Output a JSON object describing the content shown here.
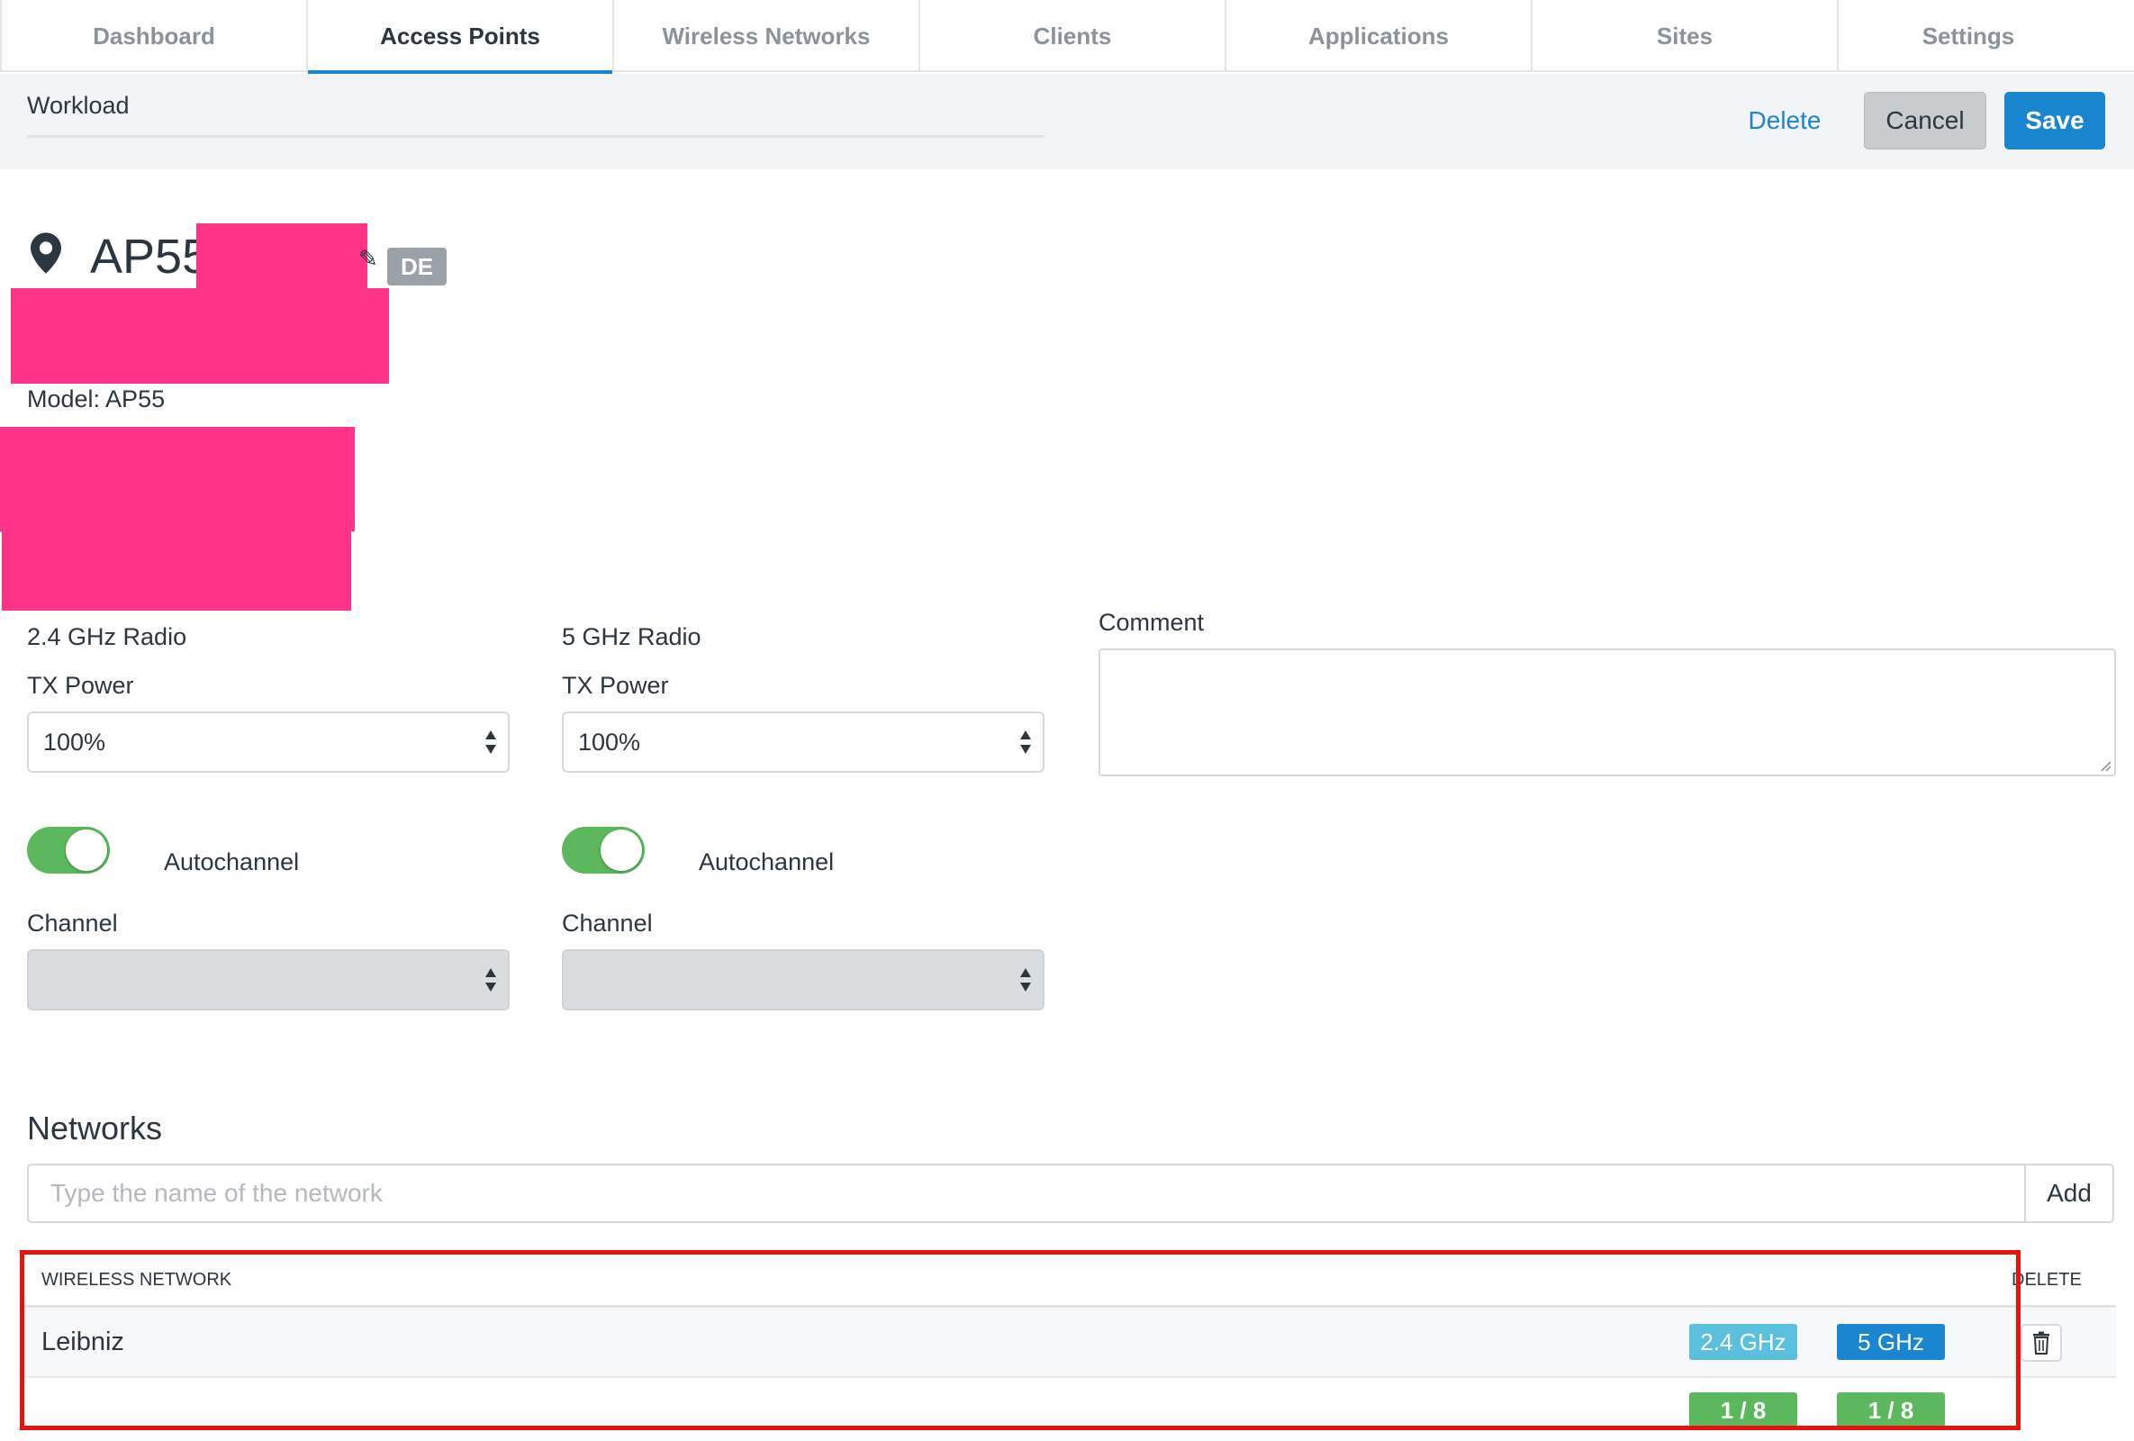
{
  "tabs": [
    {
      "label": "Dashboard"
    },
    {
      "label": "Access Points"
    },
    {
      "label": "Wireless Networks"
    },
    {
      "label": "Clients"
    },
    {
      "label": "Applications"
    },
    {
      "label": "Sites"
    },
    {
      "label": "Settings"
    }
  ],
  "active_tab": "Access Points",
  "subheader": {
    "breadcrumb": "Workload",
    "delete_label": "Delete",
    "cancel_label": "Cancel",
    "save_label": "Save"
  },
  "device": {
    "title": "AP55",
    "country_badge": "DE",
    "model": "Model: AP55",
    "icon": "map-pin-icon"
  },
  "radio_24": {
    "heading": "2.4 GHz Radio",
    "tx_label": "TX Power",
    "tx_value": "100%",
    "autochannel_label": "Autochannel",
    "autochannel_on": true,
    "channel_label": "Channel",
    "channel_value": ""
  },
  "radio_5": {
    "heading": "5 GHz Radio",
    "tx_label": "TX Power",
    "tx_value": "100%",
    "autochannel_label": "Autochannel",
    "autochannel_on": true,
    "channel_label": "Channel",
    "channel_value": ""
  },
  "comment": {
    "label": "Comment",
    "value": ""
  },
  "networks": {
    "title": "Networks",
    "input_placeholder": "Type the name of the network",
    "add_label": "Add",
    "columns": {
      "network": "WIRELESS NETWORK",
      "delete": "DELETE"
    },
    "rows": [
      {
        "name": "Leibniz",
        "band_24": "2.4 GHz",
        "band_5": "5 GHz",
        "count_24": "1 / 8",
        "count_5": "1 / 8"
      }
    ]
  },
  "colors": {
    "accent": "#1a86d0",
    "toggle_on": "#5cb85c",
    "band_24": "#5bc0de",
    "highlight": "#e8120e",
    "redaction": "#ff3388"
  }
}
